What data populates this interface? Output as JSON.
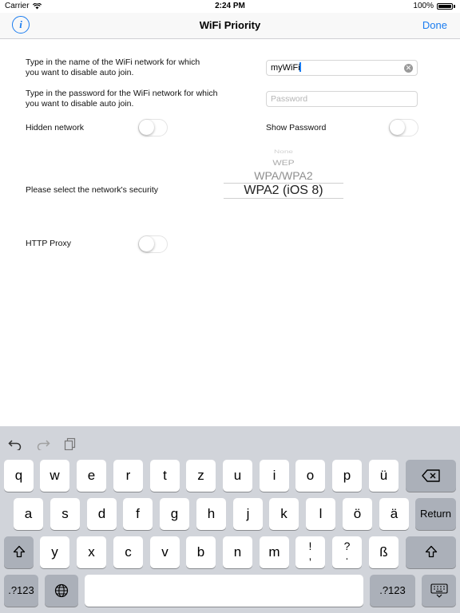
{
  "status_bar": {
    "carrier": "Carrier",
    "time": "2:24 PM",
    "battery": "100%"
  },
  "nav": {
    "title": "WiFi Priority",
    "done_label": "Done",
    "info_label": "i"
  },
  "form": {
    "network_name": {
      "label_line1": "Type in the name of the WiFi network for which",
      "label_line2": "you want to disable auto join.",
      "value": "myWiFi"
    },
    "password": {
      "label_line1": "Type in the password for the WiFi network for which",
      "label_line2": "you want to disable auto join.",
      "placeholder": "Password"
    },
    "hidden_network": {
      "label": "Hidden network",
      "enabled": false
    },
    "show_password": {
      "label": "Show Password",
      "enabled": false
    },
    "security": {
      "label": "Please select the network's security",
      "options": [
        "None",
        "WEP",
        "WPA/WPA2",
        "WPA2 (iOS 8)"
      ],
      "selected": "WPA2 (iOS 8)"
    },
    "http_proxy": {
      "label": "HTTP Proxy",
      "enabled": false
    }
  },
  "keyboard": {
    "toolbar": [
      "undo-icon",
      "redo-icon",
      "paste-icon"
    ],
    "row1": [
      "q",
      "w",
      "e",
      "r",
      "t",
      "z",
      "u",
      "i",
      "o",
      "p",
      "ü"
    ],
    "row2": [
      "a",
      "s",
      "d",
      "f",
      "g",
      "h",
      "j",
      "k",
      "l",
      "ö",
      "ä"
    ],
    "row3": [
      "y",
      "x",
      "c",
      "v",
      "b",
      "n",
      "m"
    ],
    "row3_punct": [
      {
        "top": "!",
        "bottom": ","
      },
      {
        "top": "?",
        "bottom": "."
      }
    ],
    "row3_last": "ß",
    "return_label": "Return",
    "numbers_label": ".?123",
    "icons": [
      "backspace-icon",
      "shift-icon",
      "globe-icon",
      "keyboard-dismiss-icon"
    ]
  }
}
